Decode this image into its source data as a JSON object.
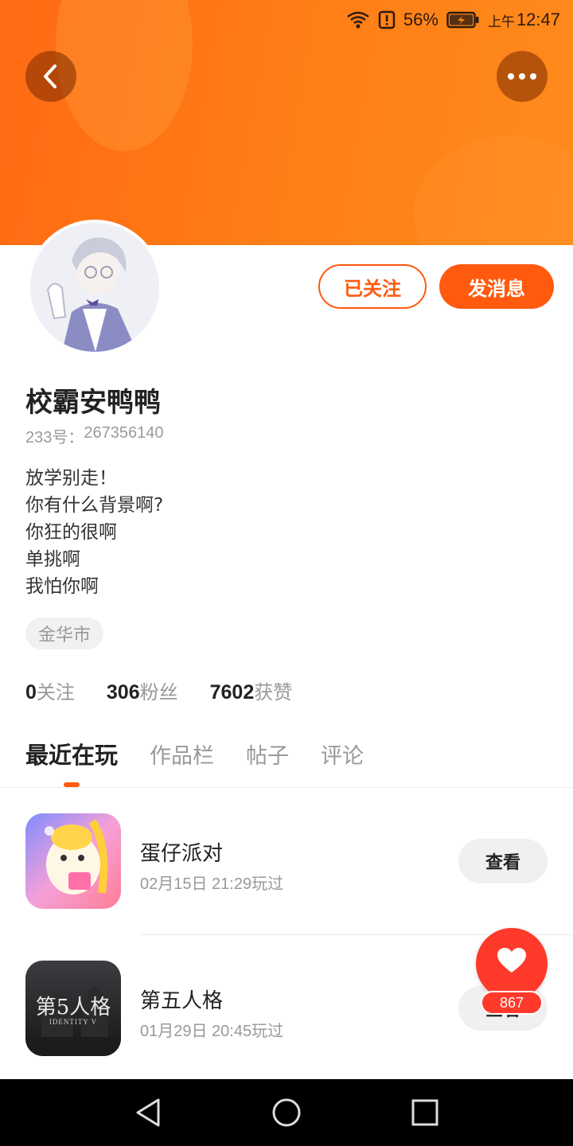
{
  "status_bar": {
    "battery_percent": "56%",
    "time_prefix": "上午",
    "time": "12:47"
  },
  "header": {
    "back_icon": "chevron-left-icon",
    "more_icon": "more-dots-icon",
    "colors": {
      "gradient_start": "#ff6a13",
      "gradient_end": "#ff8b1c"
    }
  },
  "profile": {
    "nickname": "校霸安鸭鸭",
    "uid_label": "233号：",
    "uid": "267356140",
    "bio": [
      "放学别走！",
      "你有什么背景啊?",
      "你狂的很啊",
      "单挑啊",
      "我怕你啊"
    ],
    "location": "金华市",
    "follow_label": "已关注",
    "message_label": "发消息",
    "accent_color": "#ff5a0e"
  },
  "stats": [
    {
      "value": "0",
      "label": "关注"
    },
    {
      "value": "306",
      "label": "粉丝"
    },
    {
      "value": "7602",
      "label": "获赞"
    }
  ],
  "tabs": [
    {
      "label": "最近在玩",
      "active": true
    },
    {
      "label": "作品栏",
      "active": false
    },
    {
      "label": "帖子",
      "active": false
    },
    {
      "label": "评论",
      "active": false
    }
  ],
  "games": [
    {
      "name": "蛋仔派对",
      "played": "02月15日 21:29玩过",
      "button": "查看",
      "icon": "eggy-party-icon"
    },
    {
      "name": "第五人格",
      "played": "01月29日 20:45玩过",
      "button": "查看",
      "icon": "identity-v-icon",
      "icon_text": "第5人格",
      "icon_subtext": "IDENTITY V"
    }
  ],
  "like_fab": {
    "icon": "heart-icon",
    "count": "867"
  },
  "nav_bar": {
    "back": "triangle-back-icon",
    "home": "circle-home-icon",
    "recents": "square-recents-icon"
  }
}
